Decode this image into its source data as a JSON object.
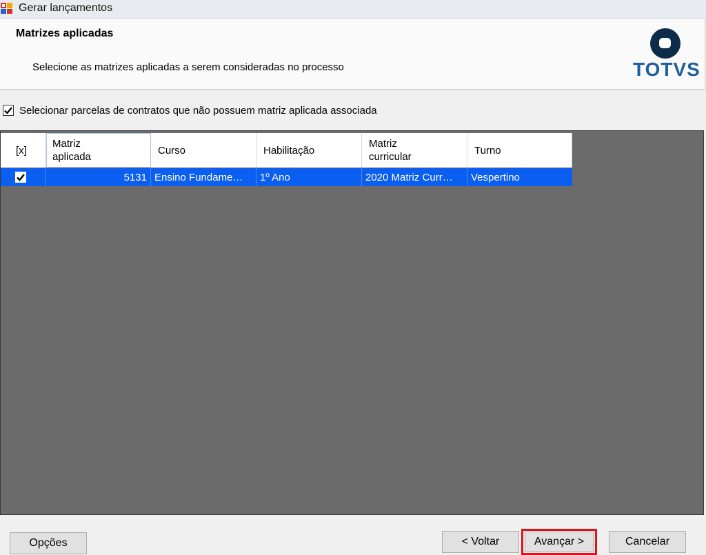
{
  "window": {
    "title": "Gerar lançamentos"
  },
  "header": {
    "title": "Matrizes aplicadas",
    "subtitle": "Selecione as matrizes aplicadas a serem consideradas no processo",
    "logo_text": "TOTVS"
  },
  "option": {
    "label": "Selecionar parcelas de contratos que não possuem matriz aplicada associada",
    "checked": true
  },
  "grid": {
    "columns": [
      {
        "line1": "[x]",
        "line2": ""
      },
      {
        "line1": "Matriz",
        "line2": "aplicada"
      },
      {
        "line1": "Curso",
        "line2": ""
      },
      {
        "line1": "Habilitação",
        "line2": ""
      },
      {
        "line1": "Matriz",
        "line2": "curricular"
      },
      {
        "line1": "Turno",
        "line2": ""
      }
    ],
    "rows": [
      {
        "selected": true,
        "matriz_aplicada": "5131",
        "curso": "Ensino Fundame…",
        "habilitacao": "1º Ano",
        "matriz_curricular": "2020 Matriz Curr…",
        "turno": "Vespertino"
      }
    ]
  },
  "buttons": {
    "opcoes": "Opções",
    "voltar": "< Voltar",
    "avancar": "Avançar >",
    "cancelar": "Cancelar"
  },
  "colors": {
    "selection": "#0a5ef0",
    "grid_bg": "#6b6b6b",
    "highlight": "#e3101a",
    "brand": "#1f5f9e"
  }
}
